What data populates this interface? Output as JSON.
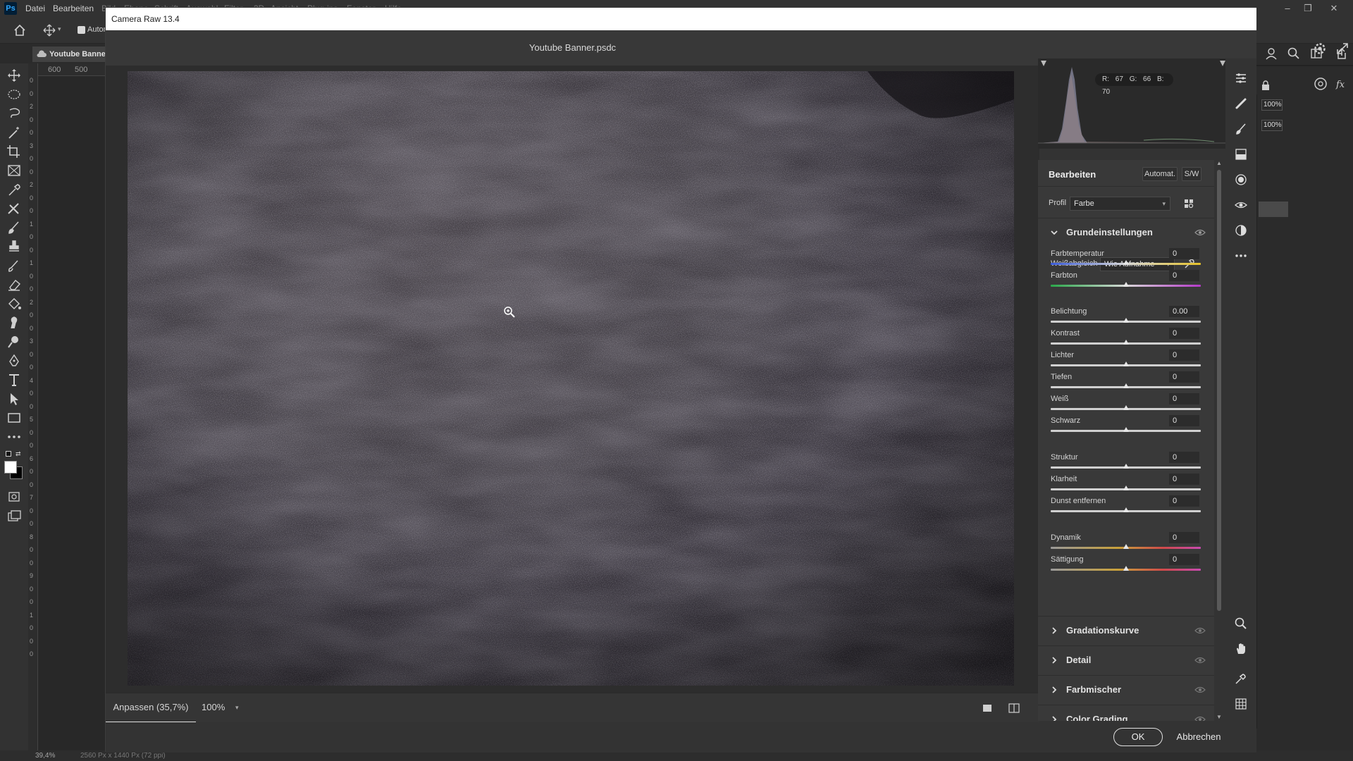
{
  "app": {
    "logo": "Ps"
  },
  "menu": {
    "items": [
      "Datei",
      "Bearbeiten",
      "Bild",
      "Ebene",
      "Schrift",
      "Auswahl",
      "Filter",
      "3D",
      "Ansicht",
      "Plug-ins",
      "Fenster",
      "Hilfe"
    ]
  },
  "options_bar": {
    "auto_select_label": "Autom"
  },
  "doc_tab": {
    "label": "Youtube Banne"
  },
  "ruler": {
    "h_labels": [
      "600",
      "500"
    ],
    "v_labels": [
      "0",
      "0",
      "2",
      "0",
      "0",
      "3",
      "0",
      "0",
      "2",
      "0",
      "0",
      "1",
      "0",
      "0",
      "1",
      "0",
      "0",
      "2",
      "0",
      "0",
      "3",
      "0",
      "0",
      "4",
      "0",
      "0",
      "5",
      "0",
      "0",
      "6",
      "0",
      "0",
      "7",
      "0",
      "0",
      "8",
      "0",
      "0",
      "9",
      "0",
      "0",
      "1",
      "0",
      "0",
      "0"
    ]
  },
  "status": {
    "zoom": "39,4%",
    "doc_info": "2560 Px x 1440 Px (72 ppi)"
  },
  "ps_right": {
    "zoom_a": "100%",
    "zoom_b": "100%"
  },
  "dialog": {
    "title": "Camera Raw 13.4",
    "filename": "Youtube Banner.psdc",
    "rgb": {
      "r": "R: 67",
      "g": "G: 66",
      "b": "B: 70"
    },
    "edit_title": "Bearbeiten",
    "auto_label": "Automat.",
    "bw_label": "S/W",
    "profile_label": "Profil",
    "profile_value": "Farbe",
    "section_basic": "Grundeinstellungen",
    "wb_label": "Weißabgleich",
    "wb_value": "Wie Aufnahme",
    "sliders": [
      {
        "label": "Farbtemperatur",
        "value": "0"
      },
      {
        "label": "Farbton",
        "value": "0"
      },
      {
        "label": "Belichtung",
        "value": "0.00"
      },
      {
        "label": "Kontrast",
        "value": "0"
      },
      {
        "label": "Lichter",
        "value": "0"
      },
      {
        "label": "Tiefen",
        "value": "0"
      },
      {
        "label": "Weiß",
        "value": "0"
      },
      {
        "label": "Schwarz",
        "value": "0"
      },
      {
        "label": "Struktur",
        "value": "0"
      },
      {
        "label": "Klarheit",
        "value": "0"
      },
      {
        "label": "Dunst entfernen",
        "value": "0"
      },
      {
        "label": "Dynamik",
        "value": "0"
      },
      {
        "label": "Sättigung",
        "value": "0"
      }
    ],
    "sections_collapsed": [
      "Gradationskurve",
      "Detail",
      "Farbmischer",
      "Color Grading"
    ],
    "zoom_fit": "Anpassen (35,7%)",
    "zoom_pct": "100%",
    "ok": "OK",
    "cancel": "Abbrechen"
  },
  "colors": {
    "accent": "#31a8ff",
    "panel": "#393939",
    "canvas": "#38343c"
  }
}
